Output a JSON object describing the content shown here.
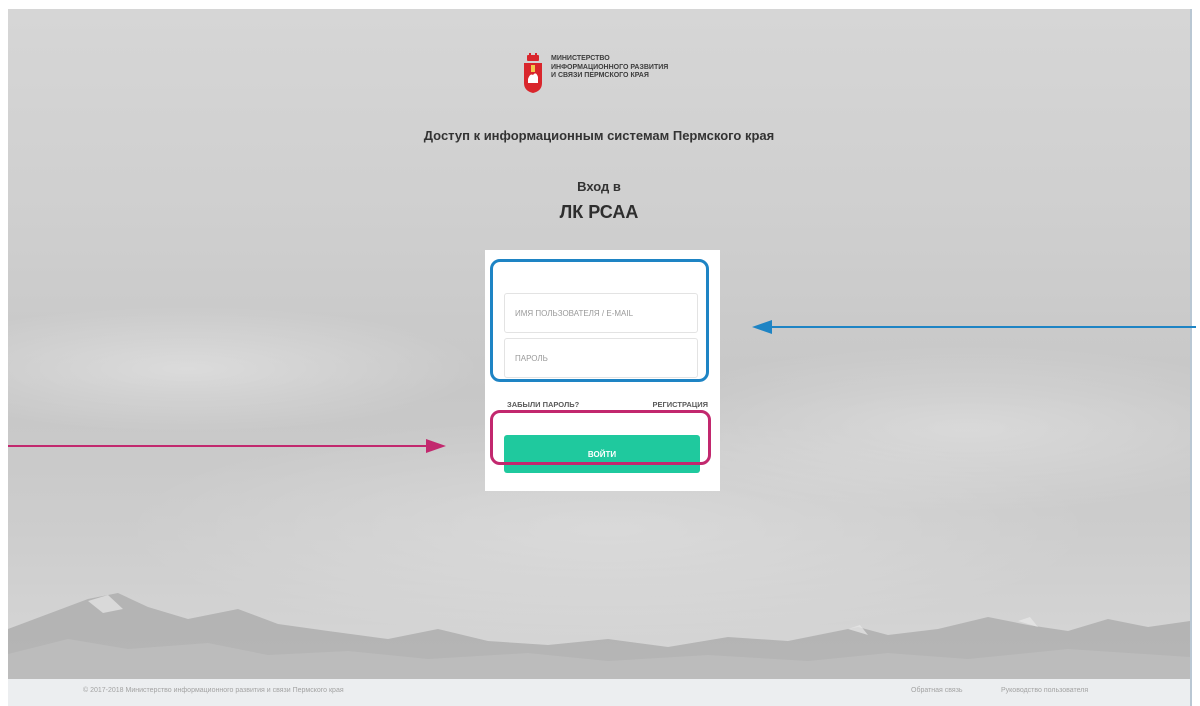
{
  "header": {
    "ministry_lines": [
      "МИНИСТЕРСТВО",
      "ИНФОРМАЦИОННОГО РАЗВИТИЯ",
      "И СВЯЗИ ПЕРМСКОГО КРАЯ"
    ],
    "portal_title": "Доступ к информационным системам Пермского края",
    "login_to": "Вход в",
    "system_name": "ЛК РСАА"
  },
  "login_form": {
    "username_placeholder": "ИМЯ ПОЛЬЗОВАТЕЛЯ / E-MAIL",
    "username_value": "",
    "password_placeholder": "ПАРОЛЬ",
    "password_value": "",
    "forgot_password": "ЗАБЫЛИ ПАРОЛЬ?",
    "register": "РЕГИСТРАЦИЯ",
    "login_button": "ВОЙТИ"
  },
  "footer": {
    "copyright": "© 2017-2018 Министерство информационного развития и связи Пермского края",
    "feedback": "Обратная связь",
    "user_manual": "Руководство пользователя"
  },
  "colors": {
    "accent": "#1fc99e",
    "coat_of_arms": "#d9262c",
    "annotation_blue": "#1e84c4",
    "annotation_pink": "#c2286e"
  },
  "icons": {
    "logo": "perm-krai-coat-of-arms-icon",
    "annotation_arrow_right": "arrow-right-icon",
    "annotation_arrow_left": "arrow-left-icon"
  }
}
